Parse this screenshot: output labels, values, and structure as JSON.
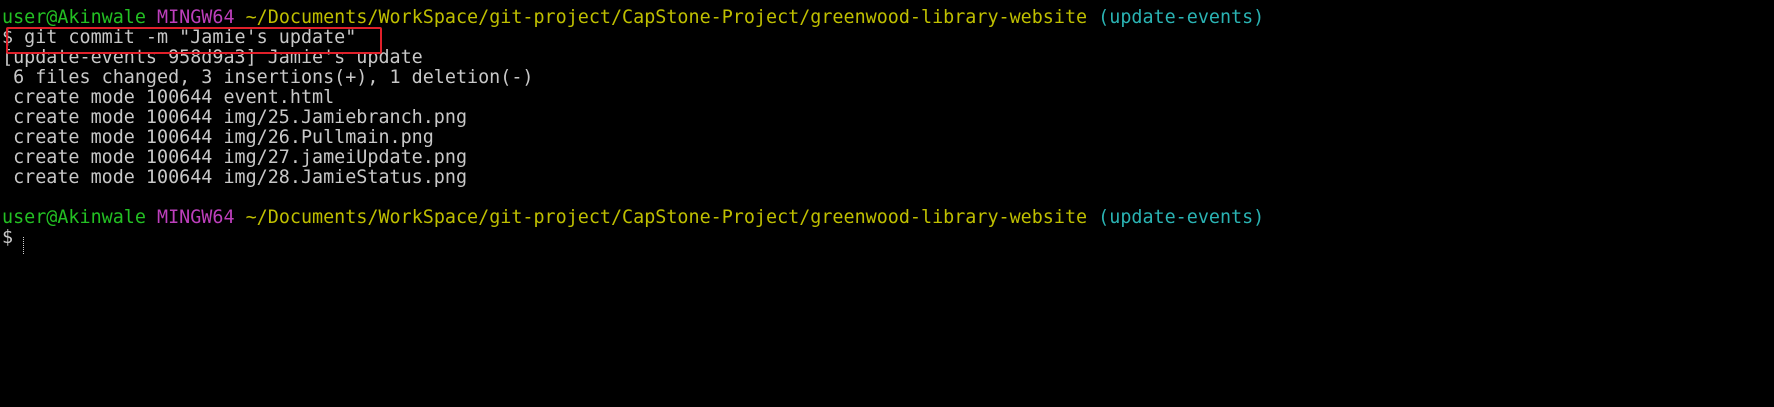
{
  "prompt": {
    "user_host": "user@Akinwale",
    "system": "MINGW64",
    "path": "~/Documents/WorkSpace/git-project/CapStone-Project/greenwood-library-website",
    "branch": "(update-events)"
  },
  "command": "$ git commit -m \"Jamie's update\"",
  "output": [
    "[update-events 958d9a3] Jamie's update",
    " 6 files changed, 3 insertions(+), 1 deletion(-)",
    " create mode 100644 event.html",
    " create mode 100644 img/25.Jamiebranch.png",
    " create mode 100644 img/26.Pullmain.png",
    " create mode 100644 img/27.jameiUpdate.png",
    " create mode 100644 img/28.JamieStatus.png"
  ],
  "next_prompt_symbol": "$",
  "colors": {
    "background": "#000000",
    "user_host": "#23c023",
    "system": "#bd3fbc",
    "path": "#bfbf00",
    "branch": "#2ab3b3",
    "text": "#c8c8c8",
    "highlight": "#e0202a"
  }
}
